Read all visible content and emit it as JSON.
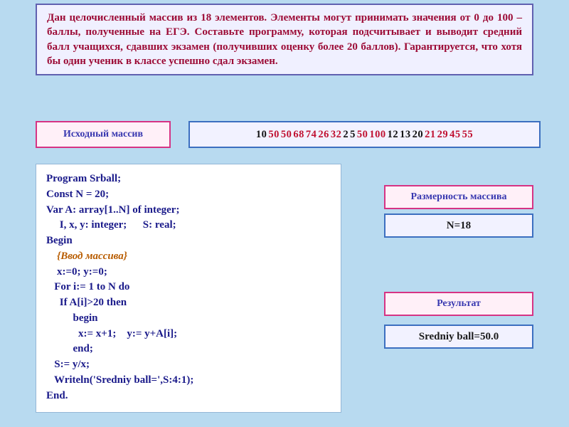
{
  "problem": "Дан целочисленный массив из 18 элементов. Элементы могут принимать значения от 0 до 100 – баллы, полученные на ЕГЭ. Составьте программу, которая подсчитывает и выводит средний балл учащихся, сдавших экзамен (получивших оценку более 20 баллов). Гарантируется, что хотя бы один ученик в классе успешно сдал экзамен.",
  "labels": {
    "source_array": "Исходный массив",
    "dimension": "Размерность массива",
    "result": "Результат"
  },
  "array_values": [
    {
      "v": "10",
      "pass": false
    },
    {
      "v": "50",
      "pass": true
    },
    {
      "v": "50",
      "pass": true
    },
    {
      "v": "68",
      "pass": true
    },
    {
      "v": "74",
      "pass": true
    },
    {
      "v": "26",
      "pass": true
    },
    {
      "v": "32",
      "pass": true
    },
    {
      "v": "2",
      "pass": false
    },
    {
      "v": "5",
      "pass": false
    },
    {
      "v": "50",
      "pass": true
    },
    {
      "v": "100",
      "pass": true
    },
    {
      "v": "12",
      "pass": false
    },
    {
      "v": "13",
      "pass": false
    },
    {
      "v": "20",
      "pass": false
    },
    {
      "v": "21",
      "pass": true
    },
    {
      "v": "29",
      "pass": true
    },
    {
      "v": "45",
      "pass": true
    },
    {
      "v": "55",
      "pass": true
    }
  ],
  "dimension_value": "N=18",
  "result_value": "Sredniy ball=50.0",
  "code": {
    "l1": "Program Srball;",
    "l2": "Const N = 20;",
    "l3": "Var A: array[1..N] of integer;",
    "l4": "     I, x, y: integer;      S: real;",
    "l5": "Begin",
    "l6": "    {Ввод массива}",
    "l7": "    x:=0; y:=0;",
    "l8": "   For i:= 1 to N do",
    "l9": "     If A[i]>20 then",
    "l10": "          begin",
    "l11": "            x:= x+1;    y:= y+A[i];",
    "l12": "          end;",
    "l13": "   S:= y/x;",
    "l14": "   Writeln('Sredniy ball=',S:4:1);",
    "l15": "End."
  }
}
